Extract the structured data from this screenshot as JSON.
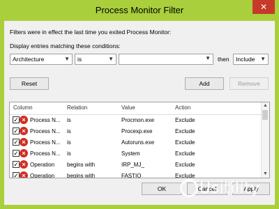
{
  "window": {
    "title": "Process Monitor Filter",
    "close_glyph": "✕"
  },
  "intro_text": "Filters were in effect the last time you exited Process Monitor:",
  "conditions_label": "Display entries matching these conditions:",
  "condition": {
    "column_value": "Architecture",
    "relation_value": "is",
    "value_text": "",
    "then_label": "then",
    "action_value": "Include"
  },
  "buttons": {
    "reset": "Reset",
    "add": "Add",
    "remove": "Remove",
    "ok": "OK",
    "cancel": "Cancel",
    "apply": "Apply"
  },
  "table": {
    "headers": [
      "Column",
      "Relation",
      "Value",
      "Action"
    ],
    "rows": [
      {
        "column": "Process N...",
        "relation": "is",
        "value": "Procmon.exe",
        "action": "Exclude"
      },
      {
        "column": "Process N...",
        "relation": "is",
        "value": "Procexp.exe",
        "action": "Exclude"
      },
      {
        "column": "Process N...",
        "relation": "is",
        "value": "Autoruns.exe",
        "action": "Exclude"
      },
      {
        "column": "Process N...",
        "relation": "is",
        "value": "System",
        "action": "Exclude"
      },
      {
        "column": "Operation",
        "relation": "begins with",
        "value": "IRP_MJ_",
        "action": "Exclude"
      },
      {
        "column": "Operation",
        "relation": "begins with",
        "value": "FASTIO_",
        "action": "Exclude"
      }
    ]
  },
  "watermark": {
    "text": "Usitility"
  },
  "icons": {
    "row_icon": "exclude-x-icon",
    "checkbox": "checkbox-checked"
  },
  "colors": {
    "title_bar": "#a9cf3c",
    "close_button": "#c7392a",
    "exclude_icon": "#cf2f22"
  }
}
